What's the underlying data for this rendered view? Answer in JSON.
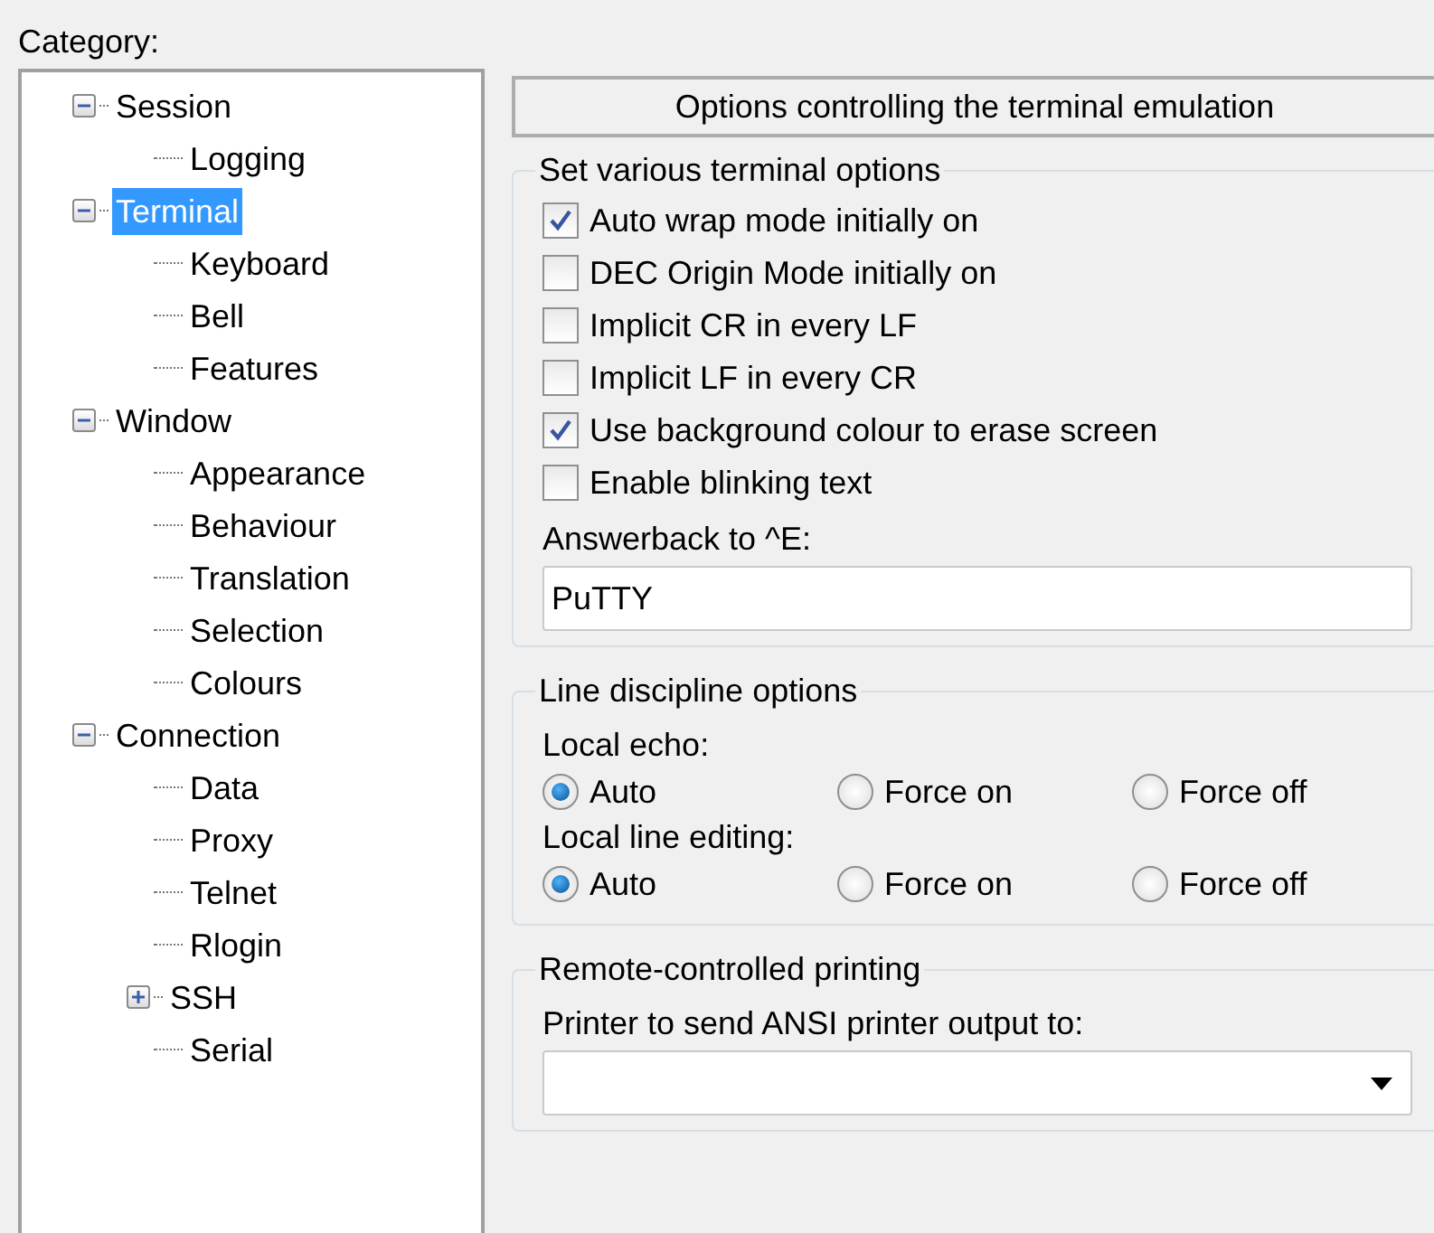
{
  "category_label": "Category:",
  "tree": [
    {
      "label": "Session",
      "selected": false,
      "expanded": true,
      "children": [
        {
          "label": "Logging",
          "selected": false
        }
      ]
    },
    {
      "label": "Terminal",
      "selected": true,
      "expanded": true,
      "children": [
        {
          "label": "Keyboard",
          "selected": false
        },
        {
          "label": "Bell",
          "selected": false
        },
        {
          "label": "Features",
          "selected": false
        }
      ]
    },
    {
      "label": "Window",
      "selected": false,
      "expanded": true,
      "children": [
        {
          "label": "Appearance",
          "selected": false
        },
        {
          "label": "Behaviour",
          "selected": false
        },
        {
          "label": "Translation",
          "selected": false
        },
        {
          "label": "Selection",
          "selected": false
        },
        {
          "label": "Colours",
          "selected": false
        }
      ]
    },
    {
      "label": "Connection",
      "selected": false,
      "expanded": true,
      "children": [
        {
          "label": "Data",
          "selected": false
        },
        {
          "label": "Proxy",
          "selected": false
        },
        {
          "label": "Telnet",
          "selected": false
        },
        {
          "label": "Rlogin",
          "selected": false
        },
        {
          "label": "SSH",
          "selected": false,
          "expanded": false
        },
        {
          "label": "Serial",
          "selected": false
        }
      ]
    }
  ],
  "panel_title": "Options controlling the terminal emulation",
  "terminal_options": {
    "title": "Set various terminal options",
    "checkboxes": [
      {
        "label": "Auto wrap mode initially on",
        "checked": true
      },
      {
        "label": "DEC Origin Mode initially on",
        "checked": false
      },
      {
        "label": "Implicit CR in every LF",
        "checked": false
      },
      {
        "label": "Implicit LF in every CR",
        "checked": false
      },
      {
        "label": "Use background colour to erase screen",
        "checked": true
      },
      {
        "label": "Enable blinking text",
        "checked": false
      }
    ],
    "answerback_label": "Answerback to ^E:",
    "answerback_value": "PuTTY"
  },
  "line_discipline": {
    "title": "Line discipline options",
    "groups": [
      {
        "label": "Local echo:",
        "options": [
          {
            "label": "Auto",
            "selected": true
          },
          {
            "label": "Force on",
            "selected": false
          },
          {
            "label": "Force off",
            "selected": false
          }
        ]
      },
      {
        "label": "Local line editing:",
        "options": [
          {
            "label": "Auto",
            "selected": true
          },
          {
            "label": "Force on",
            "selected": false
          },
          {
            "label": "Force off",
            "selected": false
          }
        ]
      }
    ]
  },
  "printing": {
    "title": "Remote-controlled printing",
    "printer_label": "Printer to send ANSI printer output to:"
  }
}
